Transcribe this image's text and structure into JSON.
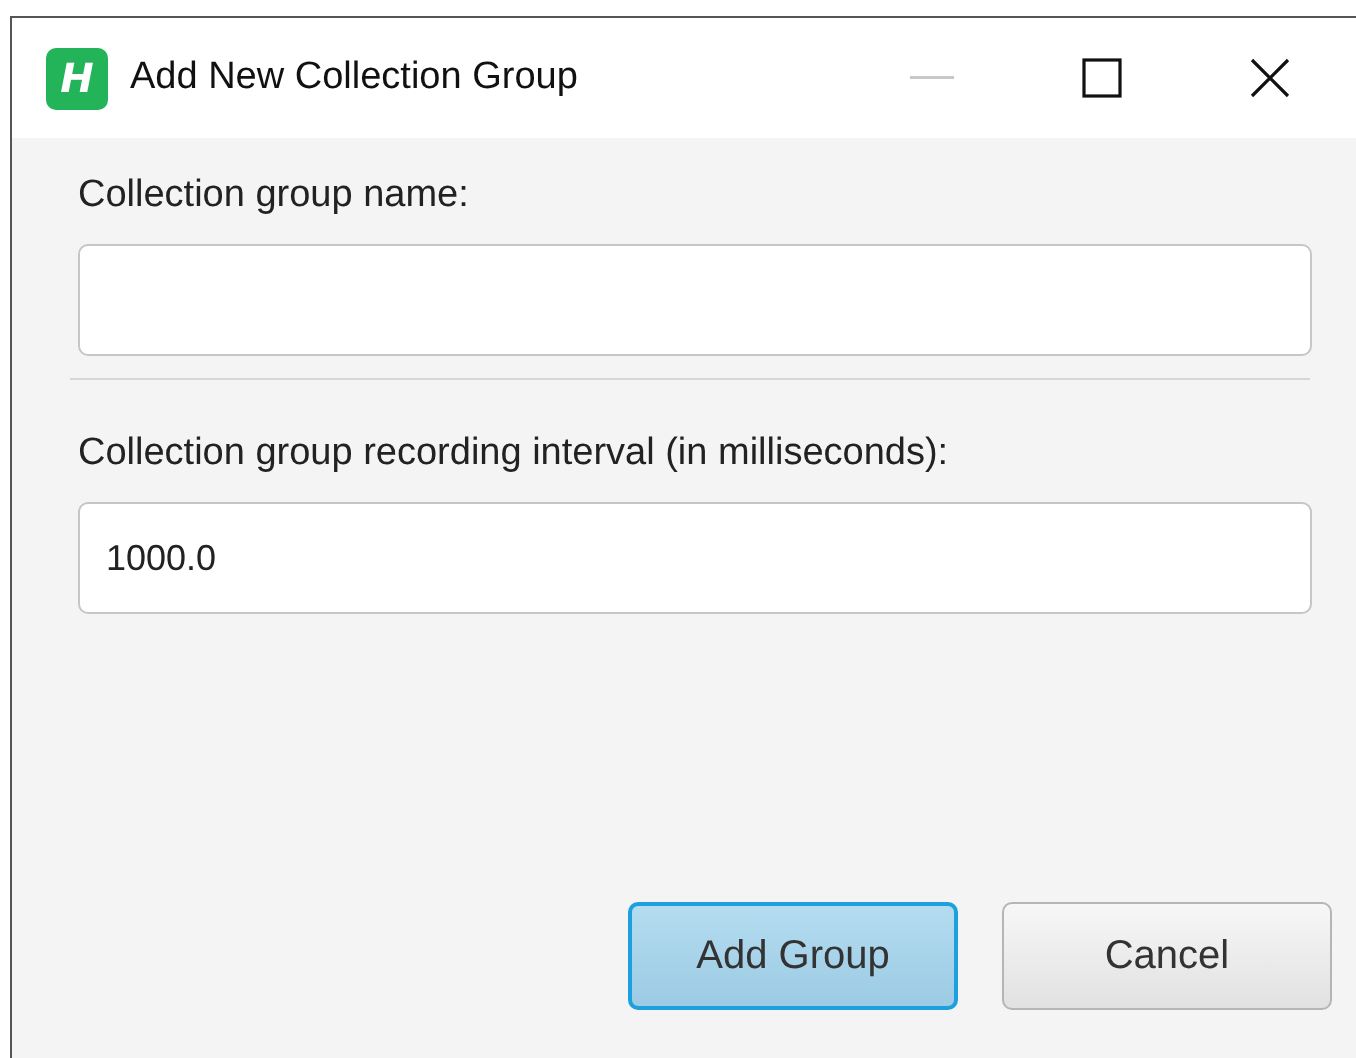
{
  "window": {
    "title": "Add New Collection Group",
    "icon_letter": "H"
  },
  "fields": [
    {
      "label": "Collection group name:"
    },
    {
      "label": "Collection group recording interval (in milliseconds):",
      "value": "1000.0"
    }
  ],
  "buttons": [
    {
      "label": "Add Group",
      "default": true
    },
    {
      "label": "Cancel",
      "default": false
    }
  ]
}
